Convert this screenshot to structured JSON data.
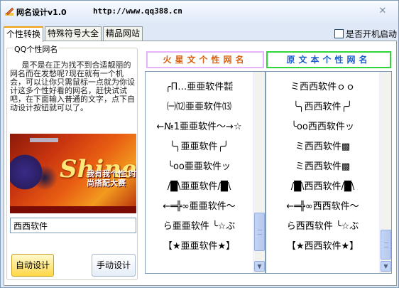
{
  "window": {
    "title": "网名设计v1.0",
    "url": "http://www.qq388.cn",
    "close_label": "✕"
  },
  "tabs": [
    {
      "label": "个性转换",
      "active": true
    },
    {
      "label": "特殊符号大全",
      "active": false
    },
    {
      "label": "精品网站",
      "active": false
    }
  ],
  "autostart": {
    "label": "是否开机启动",
    "checked": false
  },
  "left_panel": {
    "group_title": "QQ个性网名",
    "description": "是不是在正为找不到合适靓丽的网名而在发愁呢?现在就有一个机会，可以让你只需鼠标一点就为你设计这多个性好看的网名，赶快试试吧，在下面输入普通的文字，点下自动设计按钮就可以了。",
    "banner": {
      "brand": "Shine",
      "slogan": "我有我个性 时尚搭配大赛"
    },
    "input_value": "西西软件",
    "auto_button": "自动设计",
    "manual_button": "手动设计"
  },
  "columns": {
    "left_header": "火星文个性网名",
    "right_header": "原文本个性网名"
  },
  "left_items": [
    "╭Π…亜亜软件㍿",
    "㈠⑿亜亜软件⒀",
    "←№1亜亜软件～→☆",
    "╰╮亜亜软件╭╯",
    "╰oo亜亜软件ッ",
    "/█\\亜亜软件/█\\",
    "←═╬∞亜亜软件～",
    "ら亜亜软件 ╰☆ぶ",
    "【★亜亜软件★】"
  ],
  "right_items": [
    "ミ西西软件ｏｏ",
    "╰╮西西软件╭╯",
    "╰oo西西软件ッ",
    "ミ西西软件▩",
    "ミ西西软件▩",
    "/█\\西西软件/█\\",
    "←═╬∞西西软件～",
    "ら西西软件 ╰☆ぶ",
    "【★西西软件★】"
  ],
  "scroll": {
    "up_arrow": "▲",
    "down_arrow": "▼"
  },
  "colors": {
    "accent_orange": "#f0a010",
    "left_header_border": "#e8b4ff",
    "right_header_border": "#2fd63a"
  }
}
